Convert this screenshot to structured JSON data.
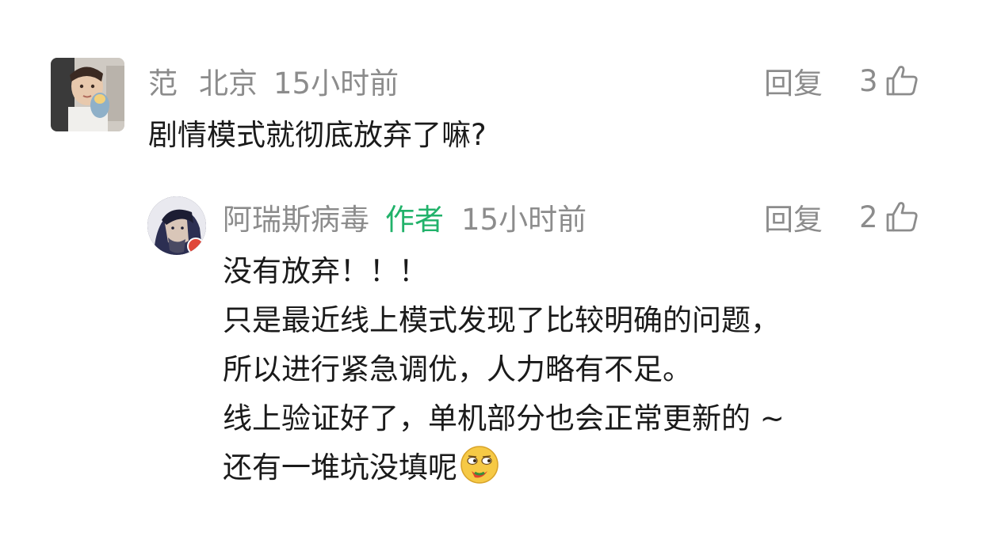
{
  "comments": [
    {
      "username": "范",
      "location": "北京",
      "time": "15小时前",
      "reply_label": "回复",
      "likes": "3",
      "text": "剧情模式就彻底放弃了嘛?"
    }
  ],
  "reply": {
    "username": "阿瑞斯病毒",
    "author_badge": "作者",
    "time": "15小时前",
    "reply_label": "回复",
    "likes": "2",
    "lines": [
      "没有放弃！！！",
      "只是最近线上模式发现了比较明确的问题，",
      "所以进行紧急调优，人力略有不足。",
      "线上验证好了，单机部分也会正常更新的 ~",
      "还有一堆坑没填呢"
    ]
  },
  "colors": {
    "meta": "#8c8c8c",
    "author_badge": "#21b26a",
    "text": "#1a1a1a"
  },
  "icons": {
    "like": "thumbs-up-icon",
    "emoji": "smirk-emoji-icon"
  }
}
